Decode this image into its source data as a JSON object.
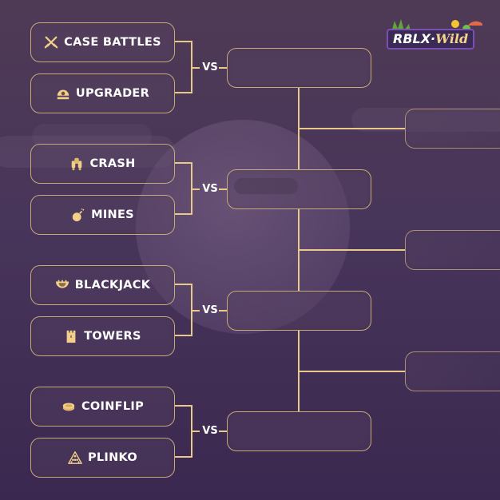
{
  "logo": {
    "brand": "RBLX",
    "separator": "·",
    "suffix": "Wild"
  },
  "vs_label": "VS",
  "colors": {
    "accent": "#c8a978",
    "background": "#48355a",
    "text": "#ffffff"
  },
  "matches": [
    {
      "games": [
        {
          "label": "CASE BATTLES",
          "icon": "crossed-swords-icon"
        },
        {
          "label": "UPGRADER",
          "icon": "upgrader-dome-icon"
        }
      ],
      "winner": ""
    },
    {
      "games": [
        {
          "label": "CRASH",
          "icon": "jetpack-icon"
        },
        {
          "label": "MINES",
          "icon": "bomb-icon"
        }
      ],
      "winner": ""
    },
    {
      "games": [
        {
          "label": "BLACKJACK",
          "icon": "crown-bowl-icon"
        },
        {
          "label": "TOWERS",
          "icon": "tower-icon"
        }
      ],
      "winner": ""
    },
    {
      "games": [
        {
          "label": "COINFLIP",
          "icon": "coin-icon"
        },
        {
          "label": "PLINKO",
          "icon": "plinko-triangle-icon"
        }
      ],
      "winner": ""
    }
  ],
  "semifinals": [
    {
      "winner": ""
    },
    {
      "winner": ""
    },
    {
      "winner": ""
    }
  ]
}
